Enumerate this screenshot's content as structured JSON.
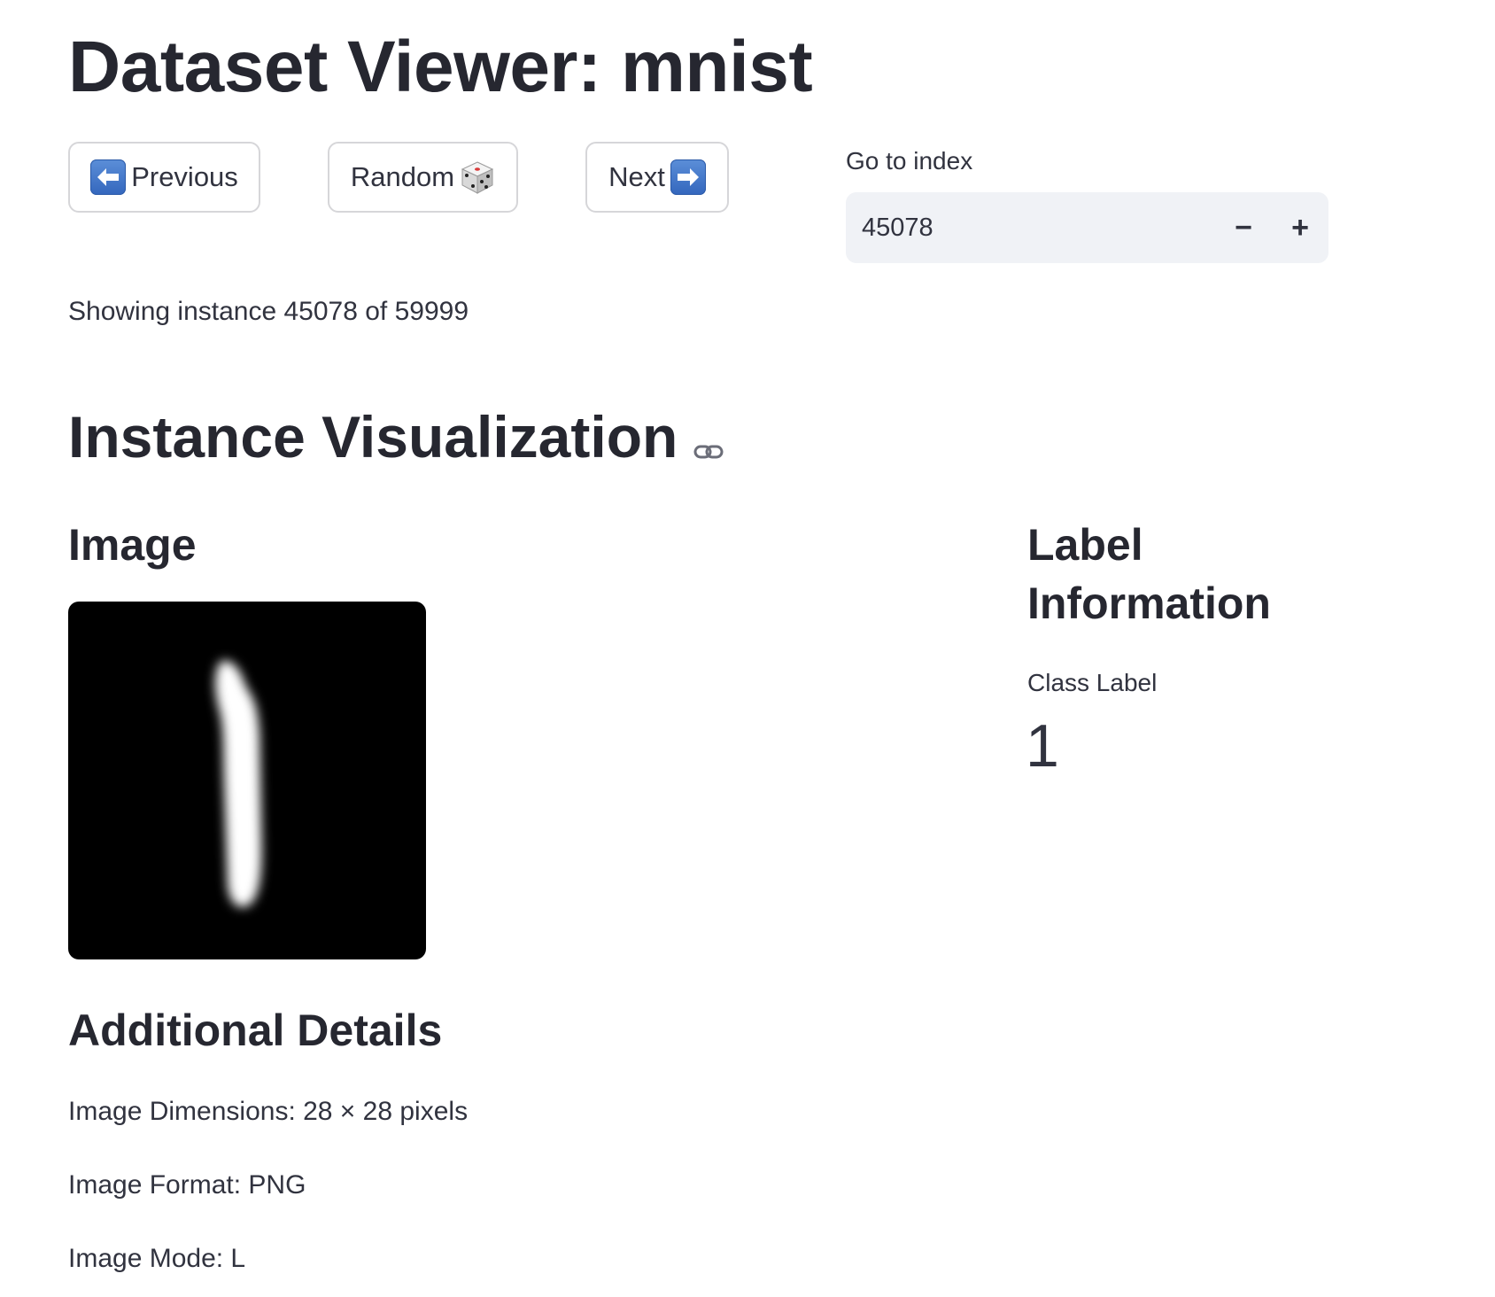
{
  "page": {
    "title": "Dataset Viewer: mnist"
  },
  "navigation": {
    "previous_label": "Previous",
    "random_label": "Random",
    "next_label": "Next"
  },
  "goto": {
    "label": "Go to index",
    "value": "45078",
    "decrement": "−",
    "increment": "+"
  },
  "status": {
    "text": "Showing instance 45078 of 59999"
  },
  "visualization": {
    "title": "Instance Visualization",
    "image_heading": "Image",
    "label_heading": "Label Information",
    "class_label_caption": "Class Label",
    "class_label_value": "1"
  },
  "details": {
    "heading": "Additional Details",
    "dimensions": "Image Dimensions: 28 × 28 pixels",
    "format": "Image Format: PNG",
    "mode": "Image Mode: L"
  },
  "icons": {
    "previous": "left-arrow-icon",
    "random": "dice-icon",
    "next": "right-arrow-icon",
    "anchor": "link-icon"
  },
  "colors": {
    "text": "#31333f",
    "heading": "#262730",
    "button_border": "#d6d6d9",
    "input_bg": "#f0f2f6",
    "emoji_blue": "#3d72c8"
  }
}
